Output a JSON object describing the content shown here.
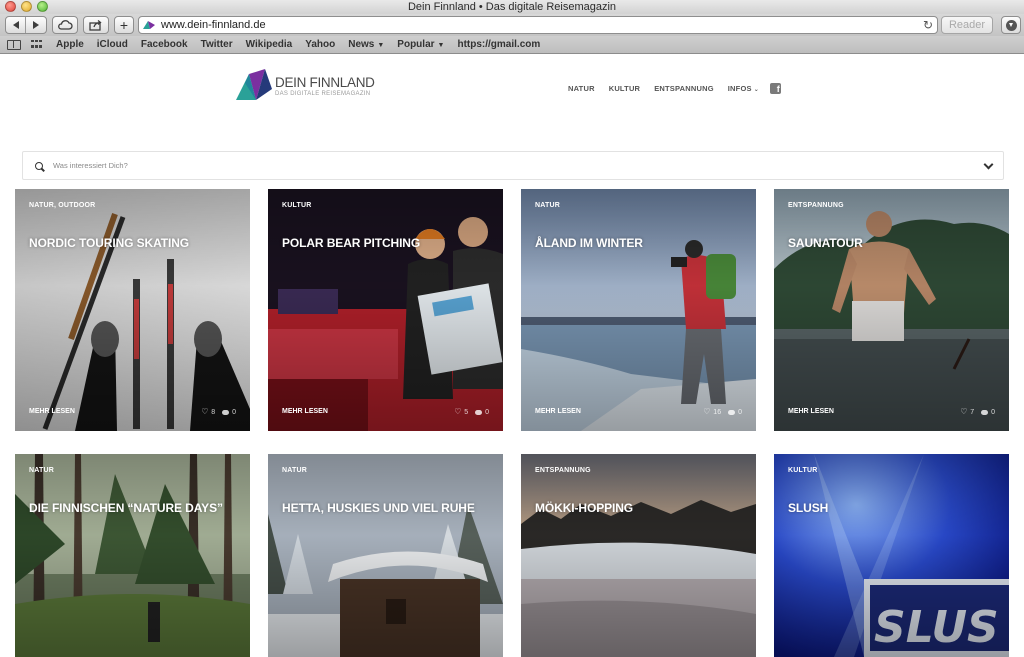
{
  "window": {
    "title": "Dein Finnland • Das digitale Reisemagazin"
  },
  "toolbar": {
    "url": "www.dein-finnland.de",
    "reader_label": "Reader"
  },
  "bookmarks": [
    {
      "label": "Apple",
      "has_menu": false
    },
    {
      "label": "iCloud",
      "has_menu": false
    },
    {
      "label": "Facebook",
      "has_menu": false
    },
    {
      "label": "Twitter",
      "has_menu": false
    },
    {
      "label": "Wikipedia",
      "has_menu": false
    },
    {
      "label": "Yahoo",
      "has_menu": false
    },
    {
      "label": "News",
      "has_menu": true
    },
    {
      "label": "Popular",
      "has_menu": true
    },
    {
      "label": "https://gmail.com",
      "has_menu": false
    }
  ],
  "site": {
    "brand_name": "DEIN FINNLAND",
    "brand_sub": "DAS DIGITALE REISEMAGAZIN",
    "nav": {
      "natur": "NATUR",
      "kultur": "KULTUR",
      "entspannung": "ENTSPANNUNG",
      "infos": "INFOS"
    },
    "colors": {
      "logo_teal": "#2aa198",
      "logo_purple": "#7b2fa0",
      "logo_navy": "#253a7a"
    }
  },
  "search": {
    "placeholder": "Was interessiert Dich?"
  },
  "cards": [
    {
      "category": "NATUR, OUTDOOR",
      "title": "NORDIC TOURING SKATING",
      "more": "MEHR LESEN",
      "likes": "8",
      "comments": "0"
    },
    {
      "category": "KULTUR",
      "title": "POLAR BEAR PITCHING",
      "more": "MEHR LESEN",
      "likes": "5",
      "comments": "0"
    },
    {
      "category": "NATUR",
      "title": "ÅLAND IM WINTER",
      "more": "MEHR LESEN",
      "likes": "16",
      "comments": "0"
    },
    {
      "category": "ENTSPANNUNG",
      "title": "SAUNATOUR",
      "more": "MEHR LESEN",
      "likes": "7",
      "comments": "0"
    },
    {
      "category": "NATUR",
      "title": "DIE FINNISCHEN “NATURE DAYS”"
    },
    {
      "category": "NATUR",
      "title": "HETTA, HUSKIES UND VIEL RUHE"
    },
    {
      "category": "ENTSPANNUNG",
      "title": "MÖKKI-HOPPING"
    },
    {
      "category": "KULTUR",
      "title": "SLUSH"
    }
  ]
}
